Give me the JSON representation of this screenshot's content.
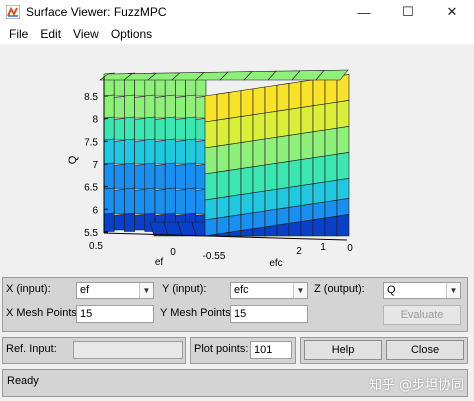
{
  "window": {
    "title": "Surface Viewer: FuzzMPC",
    "minimize_glyph": "—",
    "maximize_glyph": "☐",
    "close_glyph": "✕"
  },
  "menu": [
    "File",
    "Edit",
    "View",
    "Options"
  ],
  "plot": {
    "z_label": "Q",
    "z_ticks": [
      "8.5",
      "8",
      "7.5",
      "7",
      "6.5",
      "6",
      "5.5"
    ],
    "x_label": "ef",
    "x_ticks": [
      "0.5",
      "0",
      "-0.55"
    ],
    "y_label": "efc",
    "y_ticks": [
      "2",
      "1",
      "0"
    ],
    "colors": [
      "#0a3fc8",
      "#1a8ff0",
      "#22c8e0",
      "#3de6b0",
      "#8ef07a",
      "#d9ef3a",
      "#f8e22a"
    ]
  },
  "controls": {
    "x_input_label": "X (input):",
    "x_input_value": "ef",
    "y_input_label": "Y (input):",
    "y_input_value": "efc",
    "z_output_label": "Z (output):",
    "z_output_value": "Q",
    "x_mesh_label": "X Mesh Points:",
    "x_mesh_value": "15",
    "y_mesh_label": "Y Mesh Points:",
    "y_mesh_value": "15",
    "evaluate_label": "Evaluate",
    "ref_input_label": "Ref. Input:",
    "ref_input_value": "",
    "plot_points_label": "Plot points:",
    "plot_points_value": "101",
    "help_label": "Help",
    "close_label": "Close"
  },
  "status": {
    "text": "Ready"
  },
  "watermark": "知乎 @步坦协同"
}
